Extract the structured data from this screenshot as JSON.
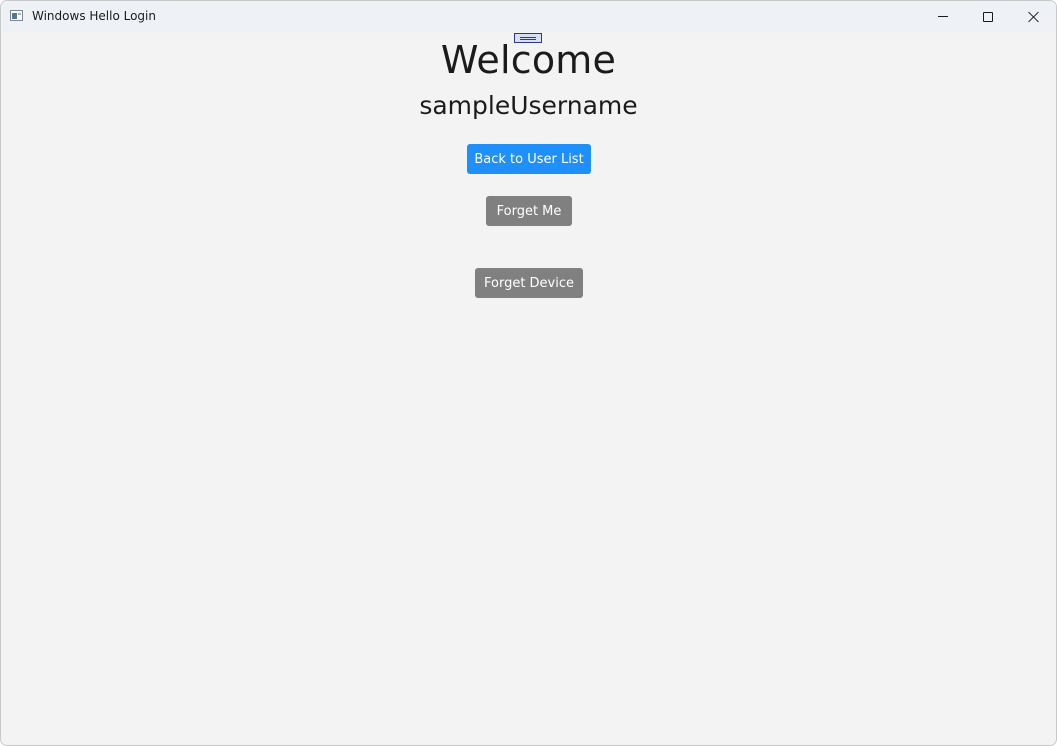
{
  "window": {
    "title": "Windows Hello Login"
  },
  "main": {
    "heading": "Welcome",
    "username": "sampleUsername",
    "buttons": {
      "back_to_user_list": "Back to User List",
      "forget_me": "Forget Me",
      "forget_device": "Forget Device"
    }
  },
  "colors": {
    "primary_button": "#1e8ffb",
    "secondary_button": "#808080",
    "background": "#f3f3f3",
    "titlebar": "#eef2f7"
  },
  "icons": {
    "app": "app-window-icon",
    "minimize": "minimize-icon",
    "maximize": "maximize-icon",
    "close": "close-icon",
    "handle": "drag-handle-icon"
  }
}
